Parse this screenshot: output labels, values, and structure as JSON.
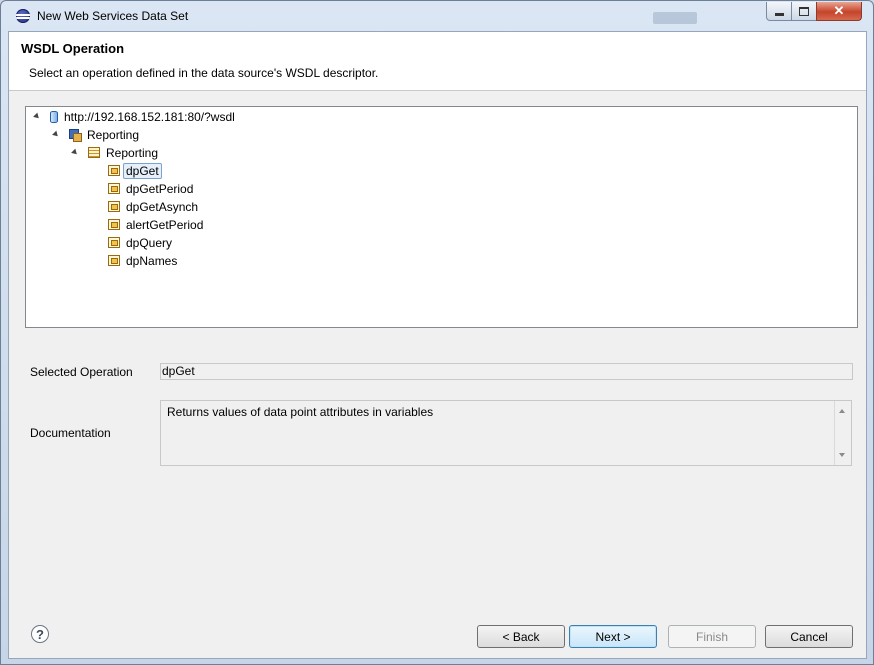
{
  "window": {
    "title": "New Web Services Data Set"
  },
  "header": {
    "title": "WSDL Operation",
    "description": "Select an operation defined in the data source's WSDL descriptor."
  },
  "tree": {
    "root": "http://192.168.152.181:80/?wsdl",
    "service": "Reporting",
    "port": "Reporting",
    "operations": [
      "dpGet",
      "dpGetPeriod",
      "dpGetAsynch",
      "alertGetPeriod",
      "dpQuery",
      "dpNames"
    ],
    "selected": "dpGet"
  },
  "fields": {
    "selected_operation_label": "Selected Operation",
    "selected_operation_value": "dpGet",
    "documentation_label": "Documentation",
    "documentation_value": "Returns values of data point attributes in variables"
  },
  "buttons": {
    "back": "< Back",
    "next": "Next >",
    "finish": "Finish",
    "cancel": "Cancel",
    "help": "?"
  }
}
